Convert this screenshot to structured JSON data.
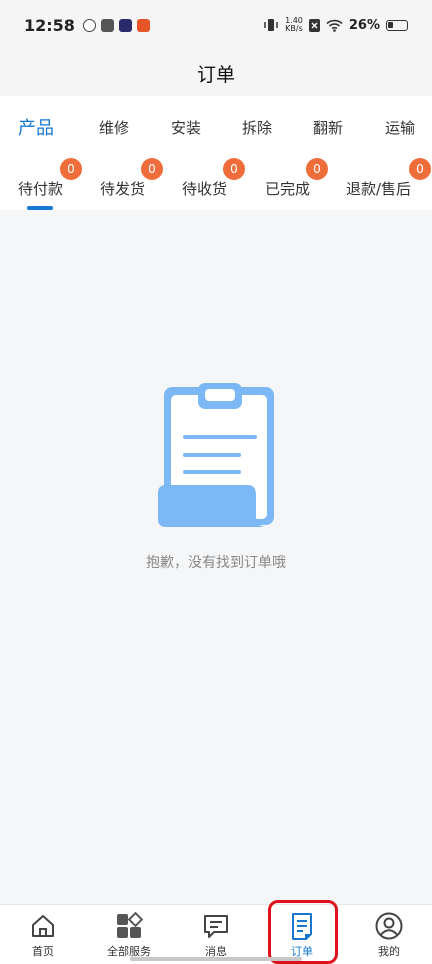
{
  "statusbar": {
    "time": "12:58",
    "net_speed_value": "1.40",
    "net_speed_unit": "KB/s",
    "battery": "26%",
    "battery_level": 0.26
  },
  "header": {
    "title": "订单"
  },
  "category_tabs": [
    {
      "label": "产品"
    },
    {
      "label": "维修"
    },
    {
      "label": "安装"
    },
    {
      "label": "拆除"
    },
    {
      "label": "翻新"
    },
    {
      "label": "运输"
    }
  ],
  "status_tabs": [
    {
      "label": "待付款",
      "count": "0"
    },
    {
      "label": "待发货",
      "count": "0"
    },
    {
      "label": "待收货",
      "count": "0"
    },
    {
      "label": "已完成",
      "count": "0"
    },
    {
      "label": "退款/售后",
      "count": "0"
    }
  ],
  "empty_state": {
    "message": "抱歉，没有找到订单哦"
  },
  "bottom_nav": [
    {
      "label": "首页",
      "icon": "home-icon"
    },
    {
      "label": "全部服务",
      "icon": "grid-icon"
    },
    {
      "label": "消息",
      "icon": "message-icon"
    },
    {
      "label": "订单",
      "icon": "order-icon"
    },
    {
      "label": "我的",
      "icon": "profile-icon"
    }
  ],
  "colors": {
    "accent": "#1677d2",
    "badge": "#ef6d3b",
    "highlight": "#e0101e"
  }
}
